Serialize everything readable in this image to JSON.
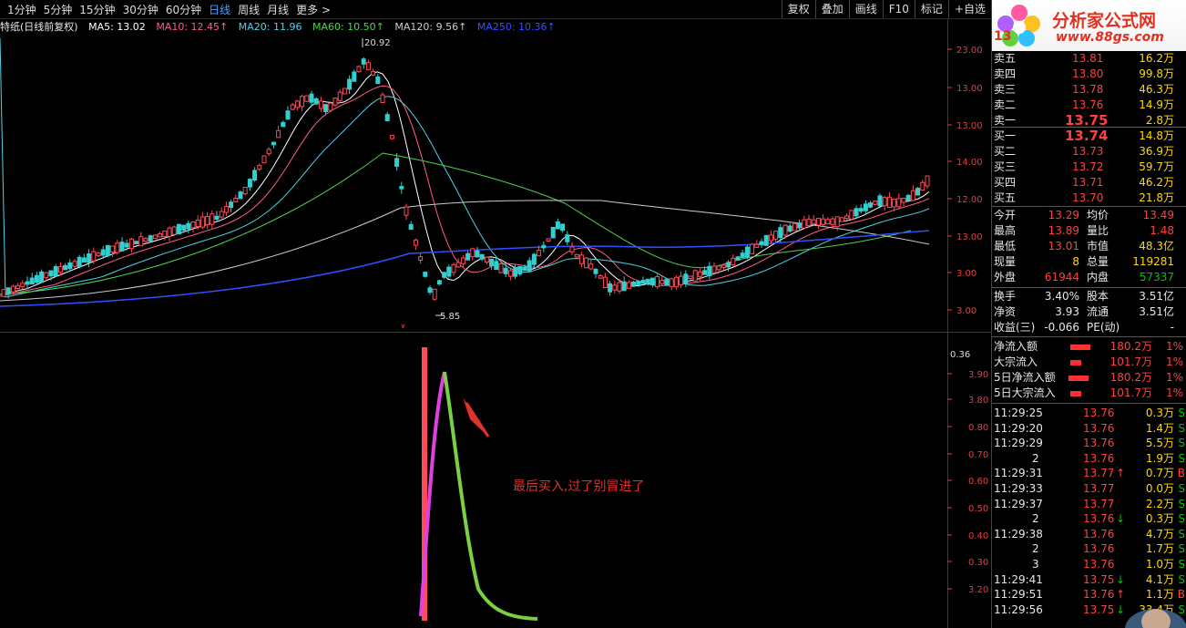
{
  "toolbar": {
    "periods": [
      "1分钟",
      "5分钟",
      "15分钟",
      "30分钟",
      "60分钟",
      "日线",
      "周线",
      "月线",
      "更多 >"
    ],
    "active_period": "日线",
    "tools": [
      "复权",
      "叠加",
      "画线",
      "F10",
      "标记",
      "+自选"
    ]
  },
  "ma_bar": {
    "title": "特纸(日线前复权)",
    "ma5": "MA5: 13.02",
    "ma10": "MA10: 12.45↑",
    "ma20": "MA20: 11.96",
    "ma60": "MA60: 10.50↑",
    "ma120": "MA120: 9.56↑",
    "ma250": "MA250: 10.36↑",
    "colors": {
      "ma5": "#ffffff",
      "ma10": "#ff5c8a",
      "ma20": "#4fd3e8",
      "ma60": "#4ed24e",
      "ma120": "#cccccc",
      "ma250": "#3050ff"
    }
  },
  "main_chart": {
    "y_labels": [
      "23.00",
      "13.00",
      "13.00",
      "14.00",
      "12.00",
      "13.00",
      "3.00",
      "3.00"
    ],
    "high_label": "20.92",
    "low_label": "5.85"
  },
  "sub_chart": {
    "top_value": "0.36",
    "y_labels": [
      "3.90",
      "3.80",
      "0.80",
      "0.70",
      "0.60",
      "0.50",
      "0.40",
      "0.30",
      "3.20"
    ],
    "annotation": "最后买入,过了别冒进了"
  },
  "logo": {
    "title": "分析家公式网",
    "url": "www.88gs.com",
    "code_partial": "13"
  },
  "quotes": {
    "asks": [
      {
        "label": "卖五",
        "price": "13.81",
        "vol": "16.2万"
      },
      {
        "label": "卖四",
        "price": "13.80",
        "vol": "99.8万"
      },
      {
        "label": "卖三",
        "price": "13.78",
        "vol": "46.3万"
      },
      {
        "label": "卖二",
        "price": "13.76",
        "vol": "14.9万"
      },
      {
        "label": "卖一",
        "price": "13.75",
        "vol": "2.8万"
      }
    ],
    "bids": [
      {
        "label": "买一",
        "price": "13.74",
        "vol": "14.8万"
      },
      {
        "label": "买二",
        "price": "13.73",
        "vol": "36.9万"
      },
      {
        "label": "买三",
        "price": "13.72",
        "vol": "59.7万"
      },
      {
        "label": "买四",
        "price": "13.71",
        "vol": "46.2万"
      },
      {
        "label": "买五",
        "price": "13.70",
        "vol": "21.8万"
      }
    ]
  },
  "stats": [
    {
      "l1": "今开",
      "v1": "13.29",
      "l2": "均价",
      "v2": "13.49"
    },
    {
      "l1": "最高",
      "v1": "13.89",
      "l2": "量比",
      "v2": "1.48"
    },
    {
      "l1": "最低",
      "v1": "13.01",
      "l2": "市值",
      "v2": "48.3亿"
    },
    {
      "l1": "现量",
      "v1": "8",
      "l2": "总量",
      "v2": "119281"
    },
    {
      "l1": "外盘",
      "v1": "61944",
      "l2": "内盘",
      "v2": "57337"
    }
  ],
  "stats2": [
    {
      "l1": "换手",
      "v1": "3.40%",
      "l2": "股本",
      "v2": "3.51亿"
    },
    {
      "l1": "净资",
      "v1": "3.93",
      "l2": "流通",
      "v2": "3.51亿"
    },
    {
      "l1": "收益(三)",
      "v1": "-0.066",
      "l2": "PE(动)",
      "v2": "-"
    }
  ],
  "flows": [
    {
      "label": "净流入额",
      "value": "180.2万",
      "pct": "1%"
    },
    {
      "label": "大宗流入",
      "value": "101.7万",
      "pct": "1%"
    },
    {
      "label": "5日净流入额",
      "value": "180.2万",
      "pct": "1%"
    },
    {
      "label": "5日大宗流入",
      "value": "101.7万",
      "pct": "1%"
    }
  ],
  "ticks": [
    {
      "time": "11:29:25",
      "price": "13.76",
      "arrow": "",
      "vol": "0.3万",
      "side": "S"
    },
    {
      "time": "11:29:20",
      "price": "13.76",
      "arrow": "",
      "vol": "1.4万",
      "side": "S"
    },
    {
      "time": "11:29:29",
      "price": "13.76",
      "arrow": "",
      "vol": "5.5万",
      "side": "S"
    },
    {
      "time": "2",
      "price": "13.76",
      "arrow": "",
      "vol": "1.9万",
      "side": "S"
    },
    {
      "time": "11:29:31",
      "price": "13.77",
      "arrow": "↑",
      "vol": "0.7万",
      "side": "B"
    },
    {
      "time": "11:29:33",
      "price": "13.77",
      "arrow": "",
      "vol": "0.0万",
      "side": "S"
    },
    {
      "time": "11:29:37",
      "price": "13.77",
      "arrow": "",
      "vol": "2.2万",
      "side": "S"
    },
    {
      "time": "2",
      "price": "13.76",
      "arrow": "↓",
      "vol": "0.3万",
      "side": "S"
    },
    {
      "time": "11:29:38",
      "price": "13.76",
      "arrow": "",
      "vol": "4.7万",
      "side": "S"
    },
    {
      "time": "2",
      "price": "13.76",
      "arrow": "",
      "vol": "1.7万",
      "side": "S"
    },
    {
      "time": "3",
      "price": "13.76",
      "arrow": "",
      "vol": "1.0万",
      "side": "S"
    },
    {
      "time": "11:29:41",
      "price": "13.75",
      "arrow": "↓",
      "vol": "4.1万",
      "side": "S"
    },
    {
      "time": "11:29:51",
      "price": "13.76",
      "arrow": "↑",
      "vol": "1.1万",
      "side": "B"
    },
    {
      "time": "11:29:56",
      "price": "13.75",
      "arrow": "↓",
      "vol": "33.4万",
      "side": "S"
    }
  ]
}
